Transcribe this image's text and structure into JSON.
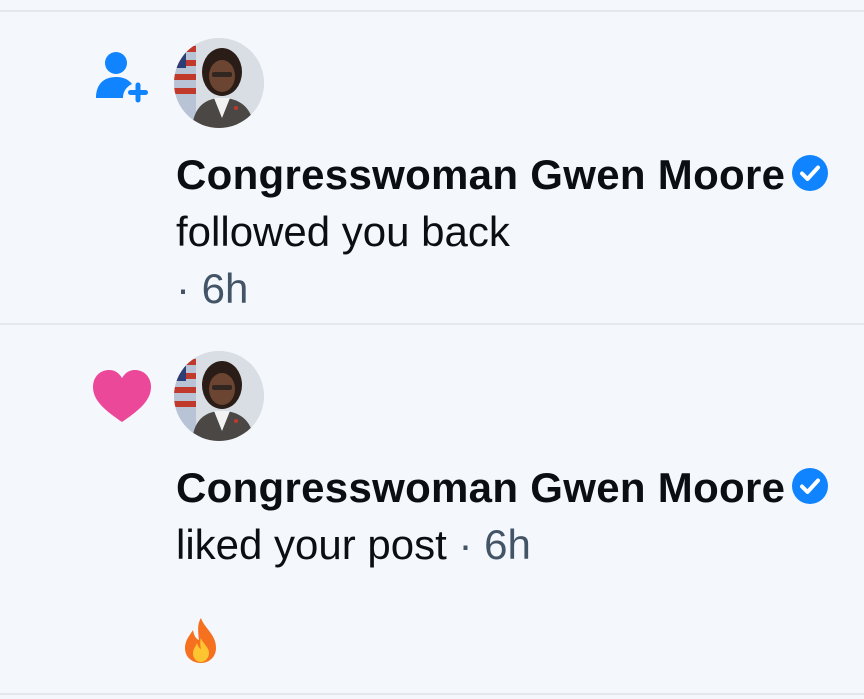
{
  "notifications": [
    {
      "type_icon": "person-plus-icon",
      "author": "Congresswoman Gwen Moore",
      "verified": true,
      "action": "followed you back",
      "time": "· 6h",
      "icon_color": "#1083fe"
    },
    {
      "type_icon": "heart-icon",
      "author": "Congresswoman Gwen Moore",
      "verified": true,
      "action": "liked your post",
      "time": "· 6h",
      "post_preview": "🔥",
      "icon_color": "#ec4899"
    }
  ],
  "colors": {
    "background": "#f4f7fc",
    "divider": "#e3e8ef",
    "verified": "#1083fe",
    "text_primary": "#0b0f14",
    "text_secondary": "#425466"
  }
}
